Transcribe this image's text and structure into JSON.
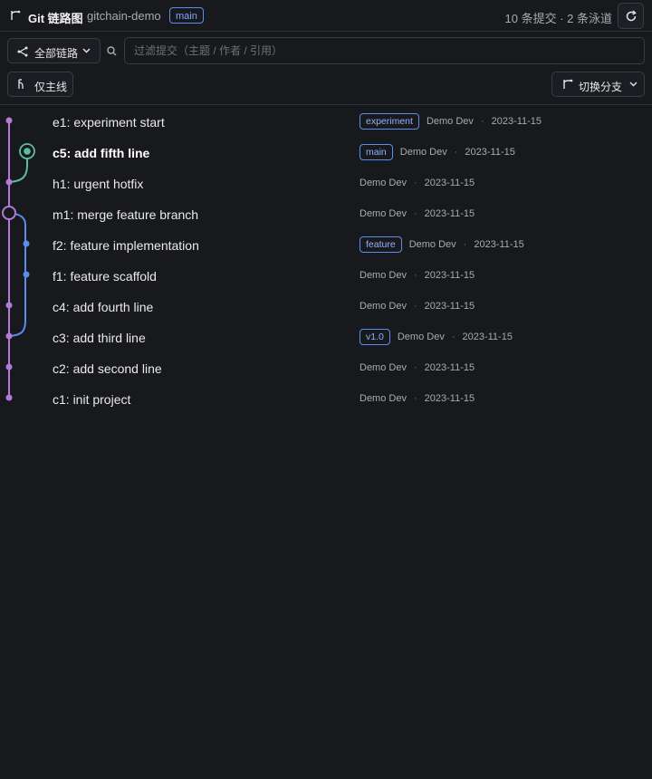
{
  "header": {
    "title": "Git 链路图",
    "repo": "gitchain-demo",
    "head_branch": "main",
    "stats": "10 条提交 · 2 条泳道",
    "refresh_label": "刷新"
  },
  "toolbar": {
    "all_lanes_label": "全部链路",
    "search_placeholder": "过滤提交（主题 / 作者 / 引用）",
    "mainline_label": "仅主线",
    "switch_branch_label": "切换分支"
  },
  "colors": {
    "background": "#18191d",
    "lane_main": "#b37ad8",
    "lane_feature": "#5b8def",
    "lane_experiment": "#5bbf9f",
    "ref_border": "#5b8def"
  },
  "commits": [
    {
      "subject": "e1: experiment start",
      "refs": [
        "experiment"
      ],
      "author": "Demo Dev",
      "date": "2023-11-15",
      "bold": false
    },
    {
      "subject": "c5: add fifth line",
      "refs": [
        "main"
      ],
      "author": "Demo Dev",
      "date": "2023-11-15",
      "bold": true
    },
    {
      "subject": "h1: urgent hotfix",
      "refs": [],
      "author": "Demo Dev",
      "date": "2023-11-15",
      "bold": false
    },
    {
      "subject": "m1: merge feature branch",
      "refs": [],
      "author": "Demo Dev",
      "date": "2023-11-15",
      "bold": false
    },
    {
      "subject": "f2: feature implementation",
      "refs": [
        "feature"
      ],
      "author": "Demo Dev",
      "date": "2023-11-15",
      "bold": false
    },
    {
      "subject": "f1: feature scaffold",
      "refs": [],
      "author": "Demo Dev",
      "date": "2023-11-15",
      "bold": false
    },
    {
      "subject": "c4: add fourth line",
      "refs": [],
      "author": "Demo Dev",
      "date": "2023-11-15",
      "bold": false
    },
    {
      "subject": "c3: add third line",
      "refs": [
        "v1.0"
      ],
      "author": "Demo Dev",
      "date": "2023-11-15",
      "bold": false
    },
    {
      "subject": "c2: add second line",
      "refs": [],
      "author": "Demo Dev",
      "date": "2023-11-15",
      "bold": false
    },
    {
      "subject": "c1: init project",
      "refs": [],
      "author": "Demo Dev",
      "date": "2023-11-15",
      "bold": false
    }
  ]
}
